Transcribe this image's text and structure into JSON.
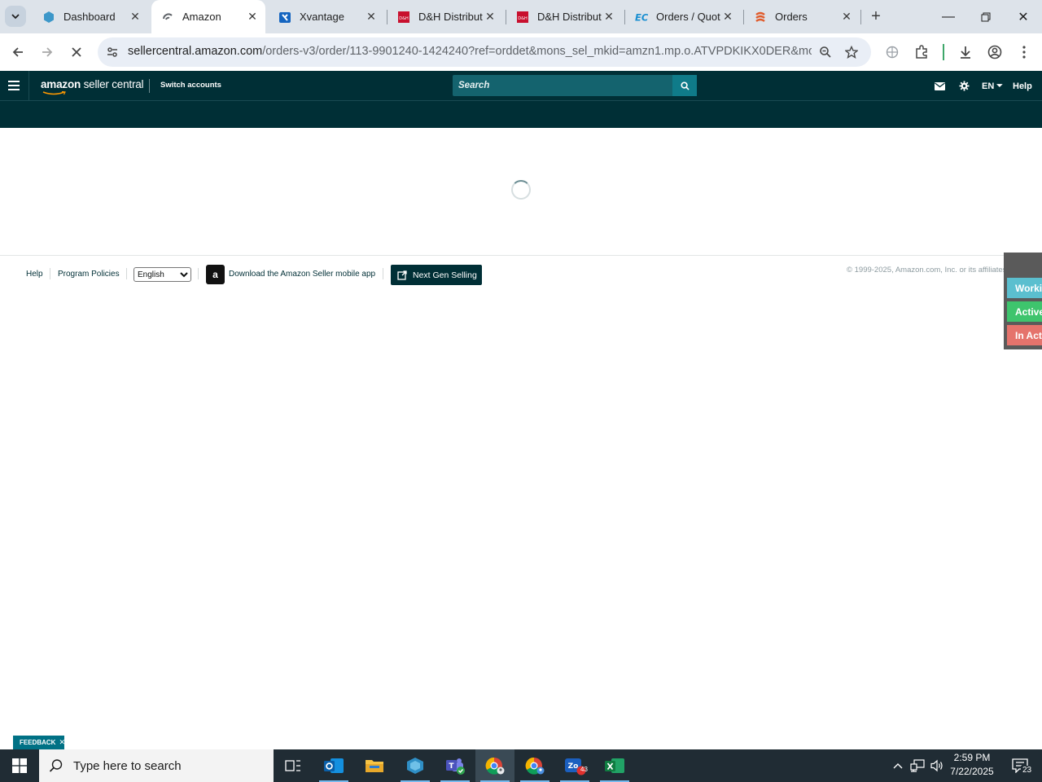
{
  "browser": {
    "tabs": [
      {
        "title": "Dashboard",
        "icon": "hexagon-icon",
        "active": false
      },
      {
        "title": "Amazon",
        "icon": "loading-icon",
        "active": true
      },
      {
        "title": "Xvantage",
        "icon": "xvantage-icon",
        "active": false
      },
      {
        "title": "D&H Distribut",
        "icon": "dh-logo-icon",
        "active": false
      },
      {
        "title": "D&H Distribut",
        "icon": "dh-logo-icon",
        "active": false
      },
      {
        "title": "Orders / Quot",
        "icon": "ec-logo-icon",
        "active": false
      },
      {
        "title": "Orders",
        "icon": "orders-logo-icon",
        "active": false
      }
    ],
    "url_host": "sellercentral.amazon.com",
    "url_path": "/orders-v3/order/113-9901240-1424240?ref=orddet&mons_sel_mkid=amzn1.mp.o.ATVPDKIKX0DER&mons_..."
  },
  "header": {
    "logo_text_bold": "amazon",
    "logo_text": "seller central",
    "switch_accounts": "Switch accounts",
    "search_placeholder": "Search",
    "language": "EN",
    "help": "Help"
  },
  "footer": {
    "help": "Help",
    "program_policies": "Program Policies",
    "language_selected": "English",
    "app_download": "Download the Amazon Seller mobile app",
    "next_gen": "Next Gen Selling",
    "copyright": "© 1999-2025, Amazon.com, Inc. or its affiliates"
  },
  "status_panel": {
    "chips": [
      {
        "label": "Working",
        "color": "#5bbfcf"
      },
      {
        "label": "Active",
        "color": "#3ec46d"
      },
      {
        "label": "In Active",
        "color": "#e5736c"
      }
    ]
  },
  "feedback": {
    "label": "FEEDBACK"
  },
  "taskbar": {
    "search_placeholder": "Type here to search",
    "time": "2:59 PM",
    "date": "7/22/2025",
    "notifications": "23",
    "zoho_badge": "43"
  },
  "colors": {
    "header_bg": "#002f36",
    "search_bg": "#14636e",
    "accent": "#007185"
  }
}
